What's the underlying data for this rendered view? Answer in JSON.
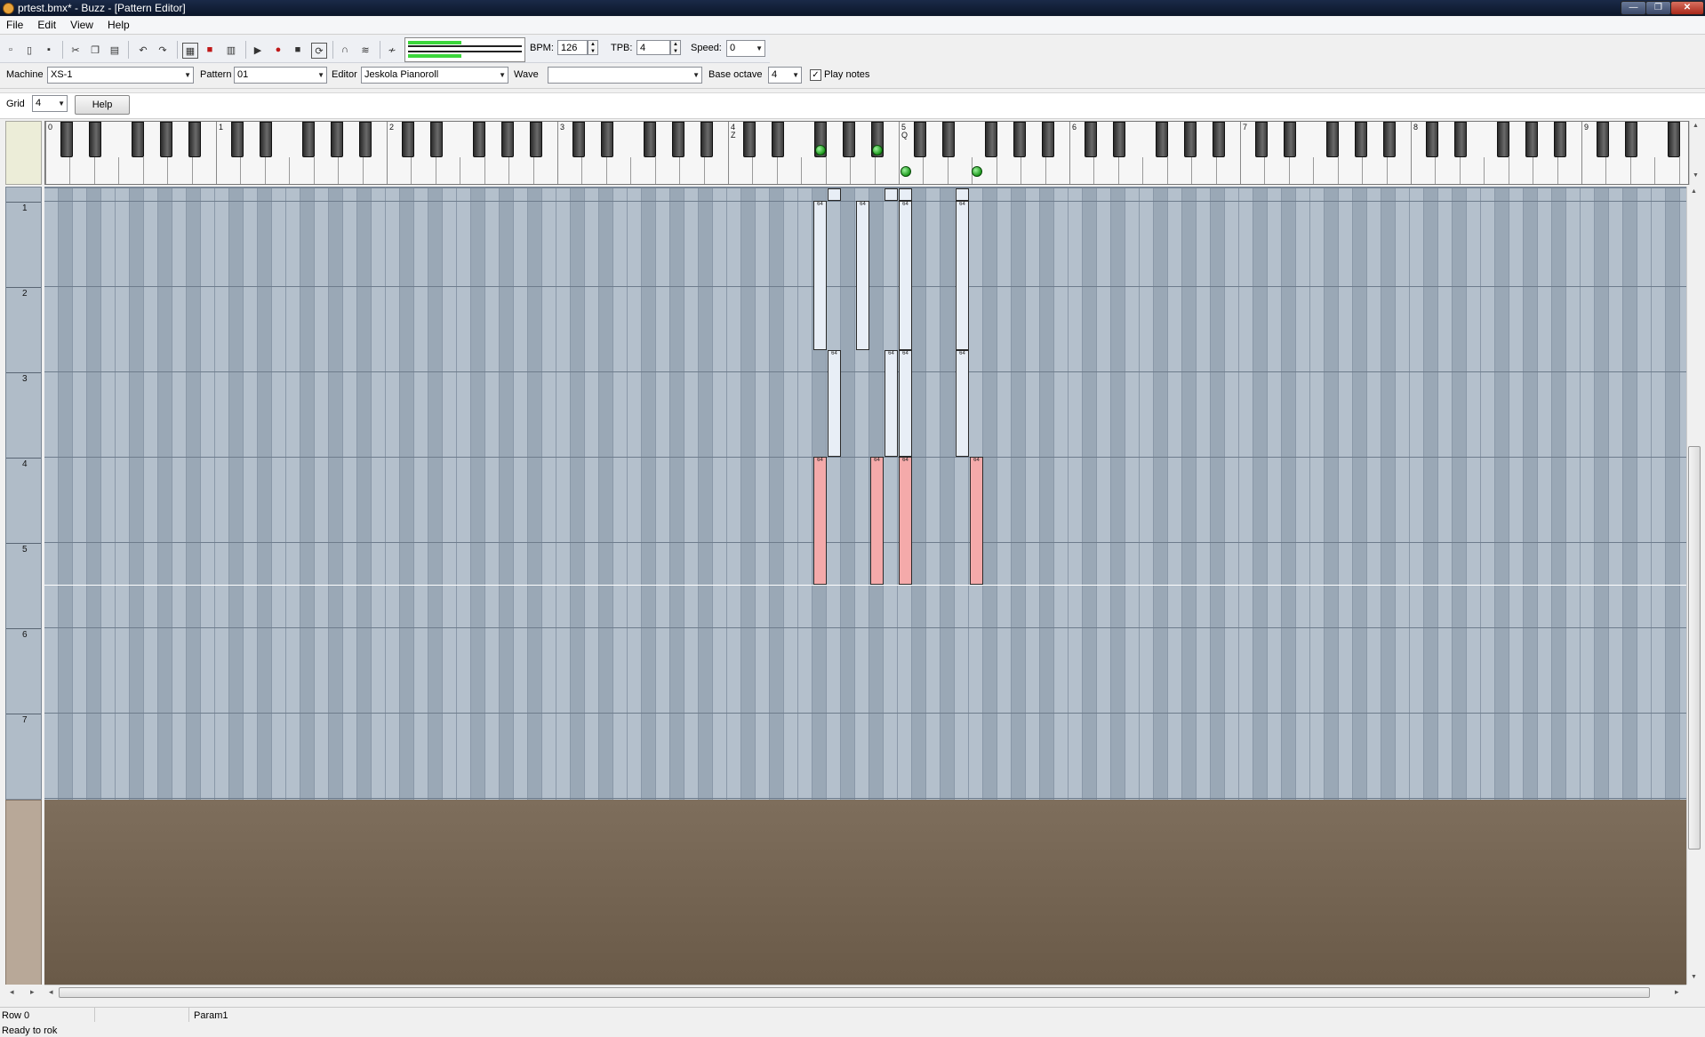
{
  "window": {
    "title": "prtest.bmx* - Buzz - [Pattern Editor]",
    "close_glyph": "✕",
    "min_glyph": "—",
    "max_glyph": "❐"
  },
  "menu": [
    "File",
    "Edit",
    "View",
    "Help"
  ],
  "toolbar": {
    "bpm_label": "BPM:",
    "bpm_value": "126",
    "tpb_label": "TPB:",
    "tpb_value": "4",
    "speed_label": "Speed:",
    "speed_value": "0"
  },
  "machinebar": {
    "machine_label": "Machine",
    "machine_value": "XS-1",
    "pattern_label": "Pattern",
    "pattern_value": "01",
    "editor_label": "Editor",
    "editor_value": "Jeskola Pianoroll",
    "wave_label": "Wave",
    "wave_value": "",
    "base_octave_label": "Base octave",
    "base_octave_value": "4",
    "play_notes_label": "Play notes",
    "play_notes_checked": true
  },
  "gridbar": {
    "grid_label": "Grid",
    "grid_value": "4",
    "help_label": "Help"
  },
  "keyboard": {
    "octave_labels": [
      "0",
      "1",
      "2",
      "3",
      "4",
      "5",
      "6",
      "7",
      "8",
      "9"
    ],
    "key_hints": [
      {
        "octave": 4,
        "text": "Z"
      },
      {
        "octave": 5,
        "text": "Q"
      }
    ],
    "active_keys_note": "green markers on pressed keys"
  },
  "pianoroll": {
    "row_labels": [
      "1",
      "2",
      "3",
      "4",
      "5",
      "6",
      "7"
    ],
    "velocity_label": "64",
    "notes": [
      {
        "col": 54,
        "start": 0.15,
        "len": 1.75,
        "color": "#e8eef6"
      },
      {
        "col": 55,
        "start": 0.0,
        "len": 0.15,
        "color": "#e8eef6"
      },
      {
        "col": 55,
        "start": 1.9,
        "len": 1.25,
        "color": "#e8eef6"
      },
      {
        "col": 57,
        "start": 0.15,
        "len": 1.75,
        "color": "#e8eef6"
      },
      {
        "col": 59,
        "start": 0.0,
        "len": 0.15,
        "color": "#e8eef6"
      },
      {
        "col": 59,
        "start": 1.9,
        "len": 1.25,
        "color": "#e8eef6"
      },
      {
        "col": 60,
        "start": 0.0,
        "len": 0.15,
        "color": "#e8eef6"
      },
      {
        "col": 60,
        "start": 0.15,
        "len": 1.75,
        "color": "#e8eef6"
      },
      {
        "col": 60,
        "start": 1.9,
        "len": 1.25,
        "color": "#e8eef6"
      },
      {
        "col": 64,
        "start": 0.0,
        "len": 0.15,
        "color": "#e8eef6"
      },
      {
        "col": 64,
        "start": 0.15,
        "len": 1.75,
        "color": "#e8eef6"
      },
      {
        "col": 64,
        "start": 1.9,
        "len": 1.25,
        "color": "#e8eef6"
      },
      {
        "col": 54,
        "start": 3.15,
        "len": 1.5,
        "color": "#f4aaaa"
      },
      {
        "col": 58,
        "start": 3.15,
        "len": 1.5,
        "color": "#f4aaaa"
      },
      {
        "col": 60,
        "start": 3.15,
        "len": 1.5,
        "color": "#f4aaaa"
      },
      {
        "col": 65,
        "start": 3.15,
        "len": 1.5,
        "color": "#f4aaaa"
      }
    ],
    "playback_position": 4.65
  },
  "status": {
    "row": "Row 0",
    "param": "Param1",
    "message": "Ready to rok"
  }
}
